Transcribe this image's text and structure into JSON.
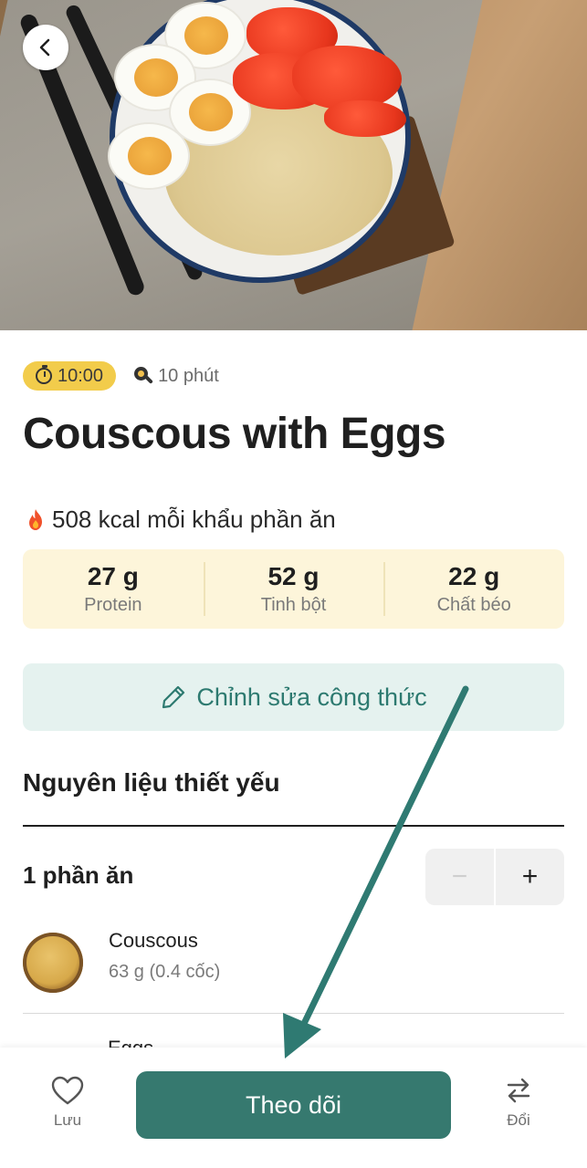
{
  "header": {
    "back_icon": "chevron-left-icon"
  },
  "recipe": {
    "timer_badge": "10:00",
    "cook_time": "10 phút",
    "title": "Couscous with Eggs",
    "kcal_text": "508 kcal mỗi khẩu phần ăn",
    "macros": [
      {
        "value": "27 g",
        "label": "Protein"
      },
      {
        "value": "52 g",
        "label": "Tinh bột"
      },
      {
        "value": "22 g",
        "label": "Chất béo"
      }
    ],
    "edit_label": "Chỉnh sửa công thức"
  },
  "ingredients_section": {
    "title": "Nguyên liệu thiết yếu",
    "servings_label": "1 phần ăn",
    "stepper": {
      "minus": "−",
      "plus": "+"
    },
    "items": [
      {
        "name": "Couscous",
        "qty": "63 g (0.4 cốc)"
      },
      {
        "name": "Eggs",
        "qty": ""
      }
    ]
  },
  "bottom_bar": {
    "save_label": "Lưu",
    "primary_label": "Theo dõi",
    "swap_label": "Đổi"
  },
  "colors": {
    "accent_teal": "#36796f",
    "timer_yellow": "#f2cc4b",
    "macro_bg": "#fdf5da",
    "edit_bg": "#e5f2ef",
    "edit_text": "#2d7a70",
    "arrow": "#2f7a72"
  }
}
